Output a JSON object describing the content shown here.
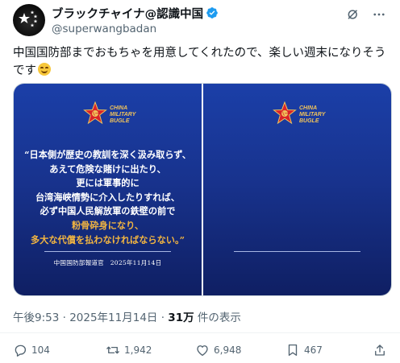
{
  "author": {
    "display_name": "ブラックチャイナ@認識中国",
    "handle": "@superwangbadan"
  },
  "tweet": {
    "text": "中国国防部までおもちゃを用意してくれたので、楽しい週末になりそうです"
  },
  "media": {
    "left": {
      "emblem_text": "CHINA\nMILITARY\nBUGLE",
      "quote_lines": [
        "“日本側が歴史の教訓を深く汲み取らず、",
        "あえて危険な賭けに出たり、",
        "更には軍事的に",
        "台湾海峡情勢に介入したりすれば、",
        "必ず中国人民解放軍の鉄壁の前で",
        "粉骨砕身になり、",
        "多大な代償を払わなければならない。”"
      ],
      "source": "中国国防部報道官　2025年11月14日"
    },
    "right": {
      "emblem_text": "CHINA\nMILITARY\nBUGLE"
    },
    "colors": {
      "panel_top": "#1b3fa8",
      "panel_bottom": "#0f1f63",
      "highlight": "#f2b541"
    }
  },
  "meta": {
    "time": "午後9:53",
    "sep1": " · ",
    "date": "2025年11月14日",
    "sep2": " · ",
    "views": "31万",
    "views_suffix": " 件の表示"
  },
  "actions": {
    "replies": "104",
    "reposts": "1,942",
    "likes": "6,948",
    "bookmarks": "467"
  },
  "icons": {
    "verified": "verified-badge-icon",
    "grok": "grok-icon",
    "more": "more-icon",
    "reply": "reply-icon",
    "repost": "repost-icon",
    "like": "like-icon",
    "bookmark": "bookmark-icon",
    "share": "share-icon"
  }
}
